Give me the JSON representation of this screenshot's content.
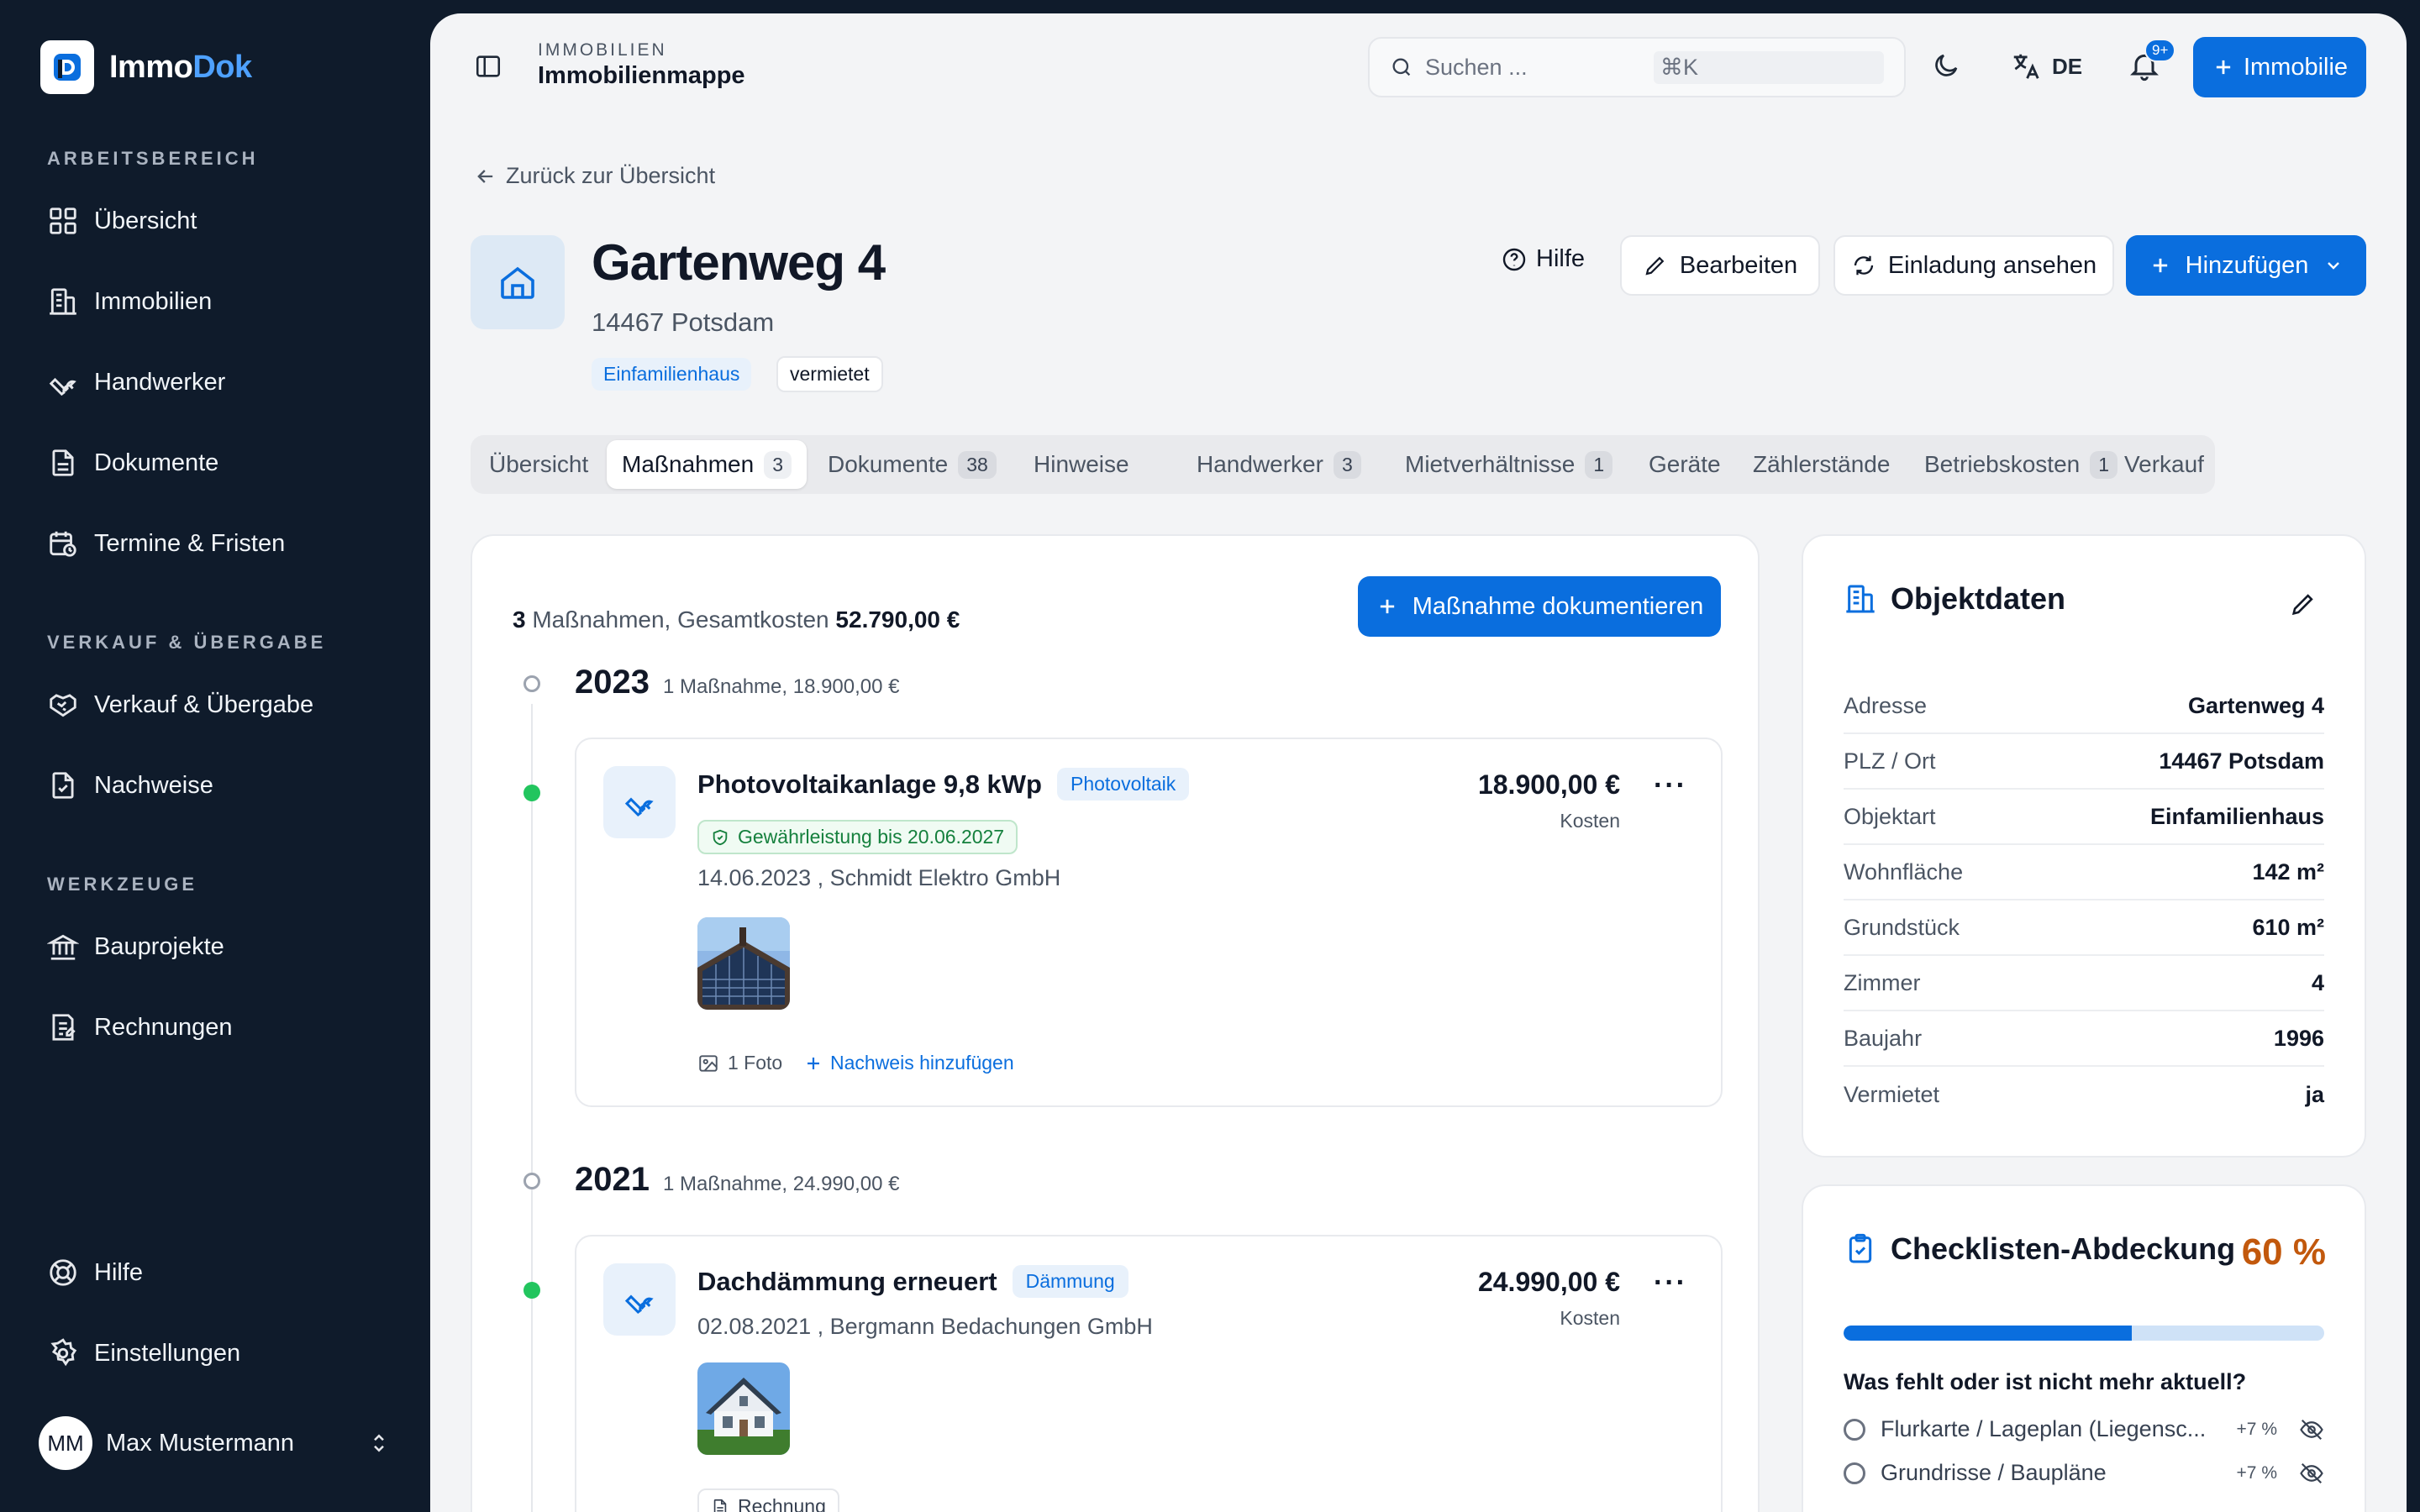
{
  "brand": {
    "name_prefix": "Immo",
    "name_suffix": "Dok"
  },
  "sidebar": {
    "sections": [
      {
        "label": "ARBEITSBEREICH",
        "items": [
          {
            "label": "Übersicht",
            "icon": "grid-icon"
          },
          {
            "label": "Immobilien",
            "icon": "building-icon"
          },
          {
            "label": "Handwerker",
            "icon": "wrench-icon"
          },
          {
            "label": "Dokumente",
            "icon": "document-icon"
          },
          {
            "label": "Termine & Fristen",
            "icon": "calendar-clock-icon"
          }
        ]
      },
      {
        "label": "VERKAUF & ÜBERGABE",
        "items": [
          {
            "label": "Verkauf & Übergabe",
            "icon": "handshake-icon"
          },
          {
            "label": "Nachweise",
            "icon": "file-check-icon"
          }
        ]
      },
      {
        "label": "WERKZEUGE",
        "items": [
          {
            "label": "Bauprojekte",
            "icon": "bank-icon"
          },
          {
            "label": "Rechnungen",
            "icon": "receipt-icon"
          }
        ]
      }
    ],
    "footer_items": [
      {
        "label": "Hilfe",
        "icon": "lifebuoy-icon"
      },
      {
        "label": "Einstellungen",
        "icon": "gear-icon"
      }
    ],
    "user": {
      "initials": "MM",
      "name": "Max Mustermann"
    }
  },
  "header": {
    "crumb_small": "IMMOBILIEN",
    "crumb_title": "Immobilienmappe",
    "search_placeholder": "Suchen ...",
    "search_shortcut": "⌘K",
    "language": "DE",
    "notification_count": "9+",
    "new_button": "Immobilie"
  },
  "page": {
    "back_link": "Zurück zur Übersicht",
    "title": "Gartenweg 4",
    "subtitle": "14467 Potsdam",
    "tag_type": "Einfamilienhaus",
    "tag_status": "vermietet",
    "actions": {
      "help": "Hilfe",
      "edit": "Bearbeiten",
      "invite": "Einladung ansehen",
      "add": "Hinzufügen"
    }
  },
  "tabs": [
    {
      "label": "Übersicht",
      "count": ""
    },
    {
      "label": "Maßnahmen",
      "count": "3"
    },
    {
      "label": "Dokumente",
      "count": "38"
    },
    {
      "label": "Hinweise",
      "count": ""
    },
    {
      "label": "Handwerker",
      "count": "3"
    },
    {
      "label": "Mietverhältnisse",
      "count": "1"
    },
    {
      "label": "Geräte",
      "count": ""
    },
    {
      "label": "Zählerstände",
      "count": ""
    },
    {
      "label": "Betriebskosten",
      "count": "1"
    },
    {
      "label": "Verkauf",
      "count": ""
    }
  ],
  "active_tab": 1,
  "measures": {
    "summary_count": "3",
    "summary_text": "Maßnahmen, Gesamtkosten",
    "summary_total": "52.790,00 €",
    "add_button": "Maßnahme dokumentieren",
    "years": [
      {
        "year": "2023",
        "sub": "1 Maßnahme, 18.900,00 €",
        "item": {
          "title": "Photovoltaikanlage 9,8 kWp",
          "tag": "Photovoltaik",
          "warranty": "Gewährleistung bis 20.06.2027",
          "meta": "14.06.2023 , Schmidt Elektro GmbH",
          "price": "18.900,00 €",
          "cost_label": "Kosten",
          "photo_count": "1 Foto",
          "add_proof": "Nachweis hinzufügen"
        }
      },
      {
        "year": "2021",
        "sub": "1 Maßnahme, 24.990,00 €",
        "item": {
          "title": "Dachdämmung erneuert",
          "tag": "Dämmung",
          "meta": "02.08.2021 , Bergmann Bedachungen GmbH",
          "price": "24.990,00 €",
          "cost_label": "Kosten",
          "attachment": "Rechnung"
        }
      }
    ]
  },
  "object_data": {
    "title": "Objektdaten",
    "rows": [
      {
        "k": "Adresse",
        "v": "Gartenweg 4"
      },
      {
        "k": "PLZ / Ort",
        "v": "14467 Potsdam"
      },
      {
        "k": "Objektart",
        "v": "Einfamilienhaus"
      },
      {
        "k": "Wohnfläche",
        "v": "142 m²"
      },
      {
        "k": "Grundstück",
        "v": "610 m²"
      },
      {
        "k": "Zimmer",
        "v": "4"
      },
      {
        "k": "Baujahr",
        "v": "1996"
      },
      {
        "k": "Vermietet",
        "v": "ja"
      }
    ]
  },
  "checklist": {
    "title": "Checklisten-Abdeckung",
    "percent_label": "60 %",
    "coverage": 0.6,
    "question": "Was fehlt oder ist nicht mehr aktuell?",
    "items": [
      {
        "label": "Flurkarte / Lageplan (Liegensc...",
        "delta": "+7 %"
      },
      {
        "label": "Grundrisse / Baupläne",
        "delta": "+7 %"
      }
    ]
  },
  "colors": {
    "primary": "#0a6ede",
    "sidebar": "#0f1b2b",
    "accent_orange": "#c2580c",
    "success": "#22c55e"
  }
}
